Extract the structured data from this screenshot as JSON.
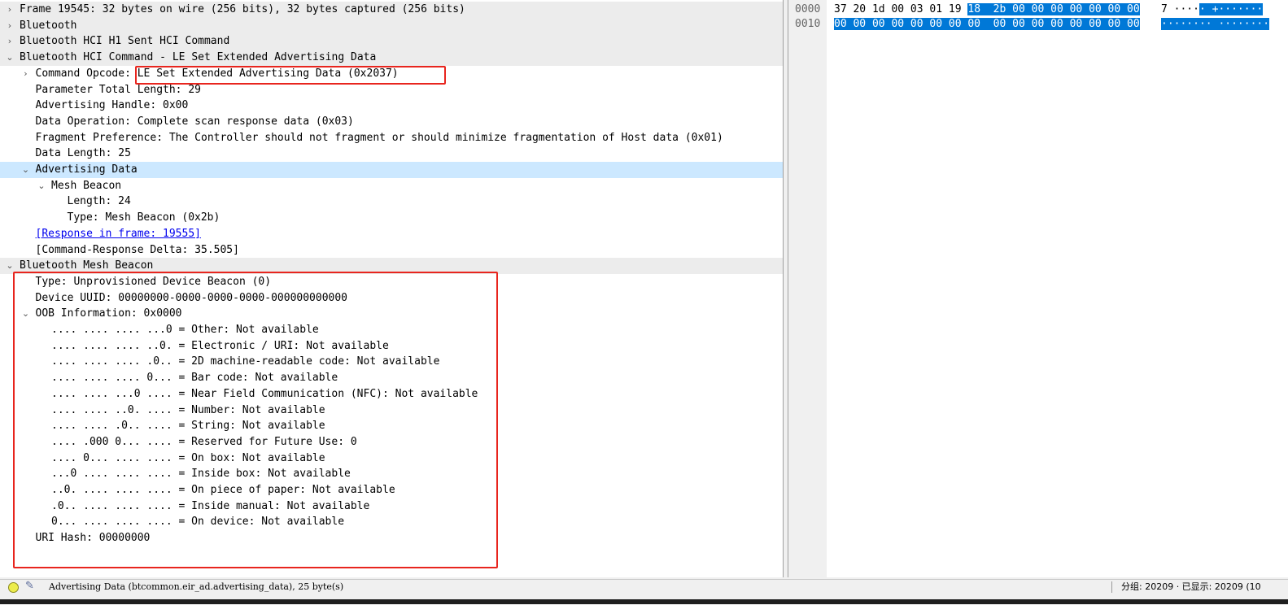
{
  "detail_tree": [
    {
      "text": "Frame 19545: 32 bytes on wire (256 bits), 32 bytes captured (256 bits)",
      "indent": 0,
      "expander": "collapsed",
      "style": "shade"
    },
    {
      "text": "Bluetooth",
      "indent": 0,
      "expander": "collapsed",
      "style": "shade"
    },
    {
      "text": "Bluetooth HCI H1 Sent HCI Command",
      "indent": 0,
      "expander": "collapsed",
      "style": "shade"
    },
    {
      "text": "Bluetooth HCI Command - LE Set Extended Advertising Data",
      "indent": 0,
      "expander": "expanded",
      "style": "shade"
    },
    {
      "text": "Command Opcode: LE Set Extended Advertising Data (0x2037)",
      "indent": 1,
      "expander": "collapsed",
      "style": ""
    },
    {
      "text": "Parameter Total Length: 29",
      "indent": 1,
      "expander": "",
      "style": ""
    },
    {
      "text": "Advertising Handle: 0x00",
      "indent": 1,
      "expander": "",
      "style": ""
    },
    {
      "text": "Data Operation: Complete scan response data (0x03)",
      "indent": 1,
      "expander": "",
      "style": ""
    },
    {
      "text": "Fragment Preference: The Controller should not fragment or should minimize fragmentation of Host data (0x01)",
      "indent": 1,
      "expander": "",
      "style": ""
    },
    {
      "text": "Data Length: 25",
      "indent": 1,
      "expander": "",
      "style": ""
    },
    {
      "text": "Advertising Data",
      "indent": 1,
      "expander": "expanded",
      "style": "sel"
    },
    {
      "text": "Mesh Beacon",
      "indent": 2,
      "expander": "expanded",
      "style": ""
    },
    {
      "text": "Length: 24",
      "indent": 3,
      "expander": "",
      "style": ""
    },
    {
      "text": "Type: Mesh Beacon (0x2b)",
      "indent": 3,
      "expander": "",
      "style": ""
    },
    {
      "text": "[Response in frame: 19555]",
      "indent": 1,
      "expander": "",
      "style": "link"
    },
    {
      "text": "[Command-Response Delta: 35.505]",
      "indent": 1,
      "expander": "",
      "style": ""
    },
    {
      "text": "Bluetooth Mesh Beacon",
      "indent": 0,
      "expander": "expanded",
      "style": "shade"
    },
    {
      "text": "Type: Unprovisioned Device Beacon (0)",
      "indent": 1,
      "expander": "",
      "style": ""
    },
    {
      "text": "Device UUID: 00000000-0000-0000-0000-000000000000",
      "indent": 1,
      "expander": "",
      "style": ""
    },
    {
      "text": "OOB Information: 0x0000",
      "indent": 1,
      "expander": "expanded",
      "style": ""
    },
    {
      "text": ".... .... .... ...0 = Other: Not available",
      "indent": 2,
      "expander": "",
      "style": ""
    },
    {
      "text": ".... .... .... ..0. = Electronic / URI: Not available",
      "indent": 2,
      "expander": "",
      "style": ""
    },
    {
      "text": ".... .... .... .0.. = 2D machine-readable code: Not available",
      "indent": 2,
      "expander": "",
      "style": ""
    },
    {
      "text": ".... .... .... 0... = Bar code: Not available",
      "indent": 2,
      "expander": "",
      "style": ""
    },
    {
      "text": ".... .... ...0 .... = Near Field Communication (NFC): Not available",
      "indent": 2,
      "expander": "",
      "style": ""
    },
    {
      "text": ".... .... ..0. .... = Number: Not available",
      "indent": 2,
      "expander": "",
      "style": ""
    },
    {
      "text": ".... .... .0.. .... = String: Not available",
      "indent": 2,
      "expander": "",
      "style": ""
    },
    {
      "text": ".... .000 0... .... = Reserved for Future Use: 0",
      "indent": 2,
      "expander": "",
      "style": ""
    },
    {
      "text": ".... 0... .... .... = On box: Not available",
      "indent": 2,
      "expander": "",
      "style": ""
    },
    {
      "text": "...0 .... .... .... = Inside box: Not available",
      "indent": 2,
      "expander": "",
      "style": ""
    },
    {
      "text": "..0. .... .... .... = On piece of paper: Not available",
      "indent": 2,
      "expander": "",
      "style": ""
    },
    {
      "text": ".0.. .... .... .... = Inside manual: Not available",
      "indent": 2,
      "expander": "",
      "style": ""
    },
    {
      "text": "0... .... .... .... = On device: Not available",
      "indent": 2,
      "expander": "",
      "style": ""
    },
    {
      "text": "URI Hash: 00000000",
      "indent": 1,
      "expander": "",
      "style": ""
    }
  ],
  "hex_dump": [
    {
      "offset": "0000",
      "bytes_plain": "37 20 1d 00 03 01 19",
      "bytes_hl": "18  2b 00 00 00 00 00 00 00",
      "ascii_plain": "7 ····",
      "ascii_hl": "· +·······"
    },
    {
      "offset": "0010",
      "bytes_plain": "",
      "bytes_hl": "00 00 00 00 00 00 00 00  00 00 00 00 00 00 00 00",
      "ascii_plain": "",
      "ascii_hl": "········ ········"
    }
  ],
  "status_bar": {
    "field_info": "Advertising Data (btcommon.eir_ad.advertising_data), 25 byte(s)",
    "packets_info": "分组: 20209 · 已显示: 20209 (10"
  },
  "icons": {
    "expander_collapsed": "chevron-right-icon",
    "expander_expanded": "chevron-down-icon",
    "status_led": "status-led-icon",
    "edit": "edit-comment-icon"
  },
  "colors": {
    "selected_row": "#cce8ff",
    "hex_highlight": "#0078d7",
    "annotation_box": "#e8251e",
    "link": "#0000ee"
  }
}
